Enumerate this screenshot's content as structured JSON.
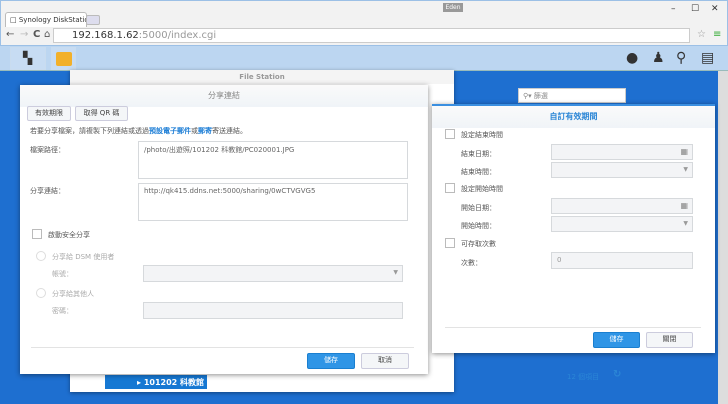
{
  "browser": {
    "tab_title": "Synology DiskStation - [",
    "user": "Eden",
    "url_host": "192.168.1.62",
    "url_rest": ":5000/index.cgi"
  },
  "file_station": {
    "title": "File Station",
    "search_placeholder": "篩選",
    "tree_item": "101202 科教館",
    "item_count": "12 個項目"
  },
  "share_dialog": {
    "title": "分享連結",
    "validity_button": "有效期限",
    "qr_button": "取得 QR 碼",
    "instruction_prefix": "若要分享檔案，請複製下列連結或透過",
    "link_email": "預設電子郵件",
    "instruction_or": "或",
    "link_mail": "郵寄",
    "instruction_suffix": "寄送連結。",
    "path_label": "檔案路徑：",
    "path_value": "/photo/出遊照/101202 科教館/PC020001.JPG",
    "link_label": "分享連結：",
    "link_value": "http://qk415.ddns.net:5000/sharing/0wCTVGVG5",
    "secure_share": "啟動安全分享",
    "share_dsm": "分享給 DSM 使用者",
    "account_label": "帳號：",
    "share_others": "分享給其他人",
    "password_label": "密碼：",
    "save": "儲存",
    "cancel": "取消"
  },
  "custom_dialog": {
    "title": "自訂有效期間",
    "set_end": "設定結束時間",
    "end_date": "結束日期：",
    "end_time": "結束時間：",
    "set_start": "設定開始時間",
    "start_date": "開始日期：",
    "start_time": "開始時間：",
    "access_count": "可存取次數",
    "count_label": "次數：",
    "count_value": "0",
    "save": "儲存",
    "close": "關閉"
  },
  "colors": {
    "desktop": "#1e6fd0",
    "accent": "#2f95e6",
    "taskbar": "#bcd6f1"
  }
}
